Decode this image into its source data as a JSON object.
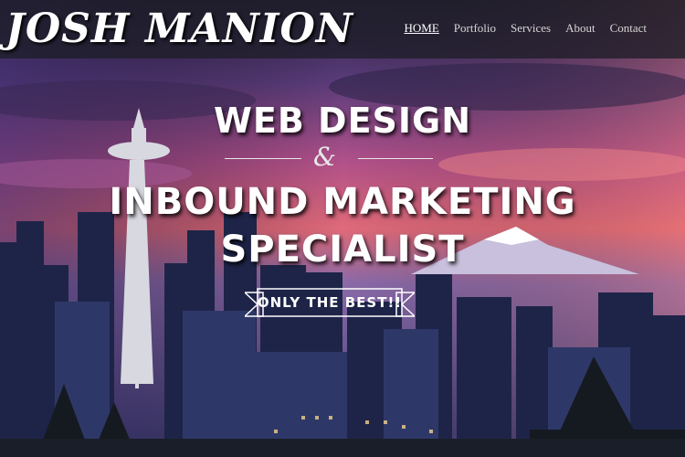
{
  "brand": {
    "logo": "JOSH MANION"
  },
  "nav": {
    "items": [
      {
        "label": "HOME",
        "active": true
      },
      {
        "label": "Portfolio",
        "active": false
      },
      {
        "label": "Services",
        "active": false
      },
      {
        "label": "About",
        "active": false
      },
      {
        "label": "Contact",
        "active": false
      }
    ]
  },
  "hero": {
    "line1": "WEB DESIGN",
    "ampersand": "&",
    "line2": "INBOUND MARKETING",
    "line3": "SPECIALIST",
    "ribbon": "ONLY THE BEST!!"
  },
  "colors": {
    "nav_bg": "#1e1e28",
    "text": "#ffffff",
    "sky_pink": "#e25a78",
    "sky_purple": "#4a3a8a"
  }
}
